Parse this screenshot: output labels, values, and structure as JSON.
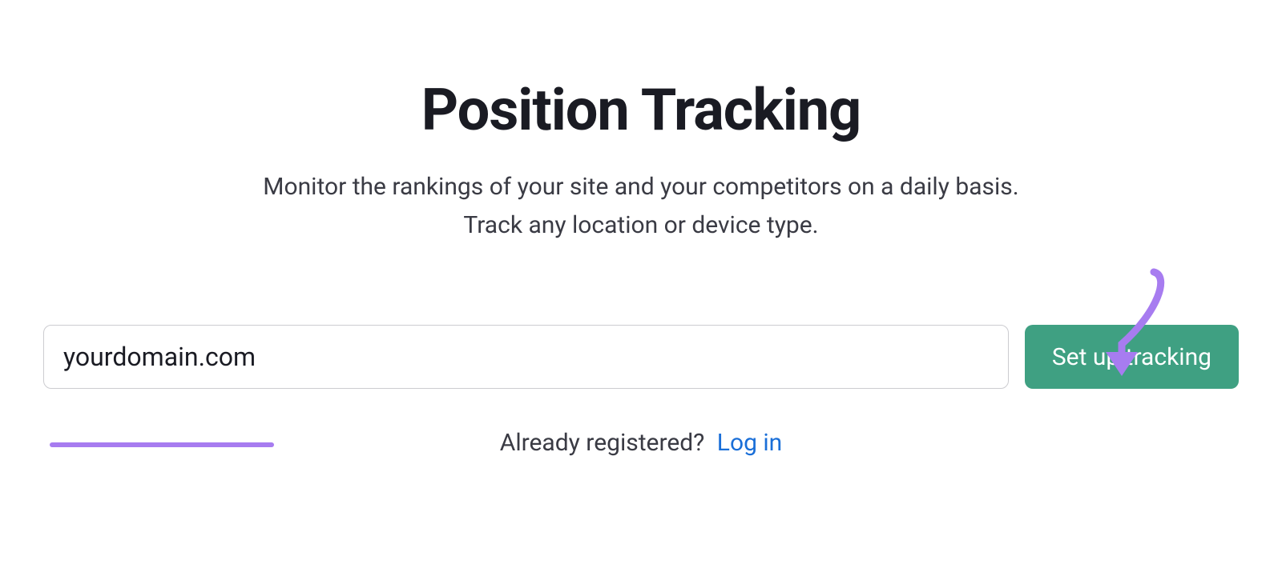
{
  "header": {
    "title": "Position Tracking",
    "subtitle_line1": "Monitor the rankings of your site and your competitors on a daily basis.",
    "subtitle_line2": "Track any location or device type."
  },
  "form": {
    "domain_value": "yourdomain.com",
    "button_label": "Set up tracking"
  },
  "prompt": {
    "already_registered": "Already registered?",
    "login_label": "Log in"
  },
  "colors": {
    "accent_purple": "#a77cf0",
    "button_green": "#3fa082",
    "link_blue": "#1a6fd8"
  }
}
